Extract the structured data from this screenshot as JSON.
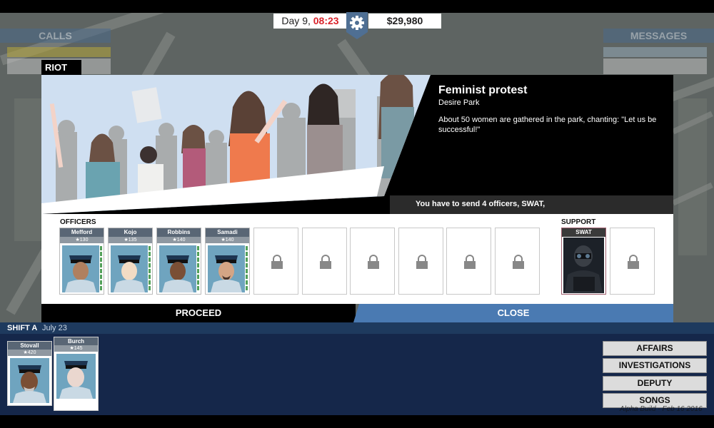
{
  "hud": {
    "day_label": "Day 9,",
    "time": "08:23",
    "money": "$29,980",
    "settings_icon": "gear-icon"
  },
  "background": {
    "calls_title": "CALLS",
    "messages_title": "MESSAGES"
  },
  "event": {
    "type_tab": "RIOT",
    "title": "Feminist protest",
    "location": "Desire Park",
    "description": "About 50 women are gathered in the park, chanting: \"Let us be successful!\"",
    "requirement": "You have to send 4 officers, SWAT,"
  },
  "roster": {
    "officers_label": "OFFICERS",
    "support_label": "SUPPORT",
    "officers": [
      {
        "name": "Mefford",
        "rank": "★130"
      },
      {
        "name": "Kojo",
        "rank": "★135"
      },
      {
        "name": "Robbins",
        "rank": "★140"
      },
      {
        "name": "Samadi",
        "rank": "★140"
      }
    ],
    "empty_slot_icon": "lock-icon",
    "support": [
      {
        "name": "SWAT"
      }
    ]
  },
  "actions": {
    "proceed": "PROCEED",
    "close": "CLOSE"
  },
  "shift": {
    "label": "SHIFT A",
    "date": "July 23",
    "officers": [
      {
        "name": "Stovall",
        "rank": "★420"
      },
      {
        "name": "Burch",
        "rank": "★145"
      }
    ]
  },
  "side_menu": [
    "AFFAIRS",
    "INVESTIGATIONS",
    "DEPUTY",
    "SONGS"
  ],
  "build_text": "Alpha Build - Feb 16 2016",
  "colors": {
    "close_button": "#4a7ab2",
    "time": "#d9242b",
    "shift_bg": "#15274a"
  }
}
